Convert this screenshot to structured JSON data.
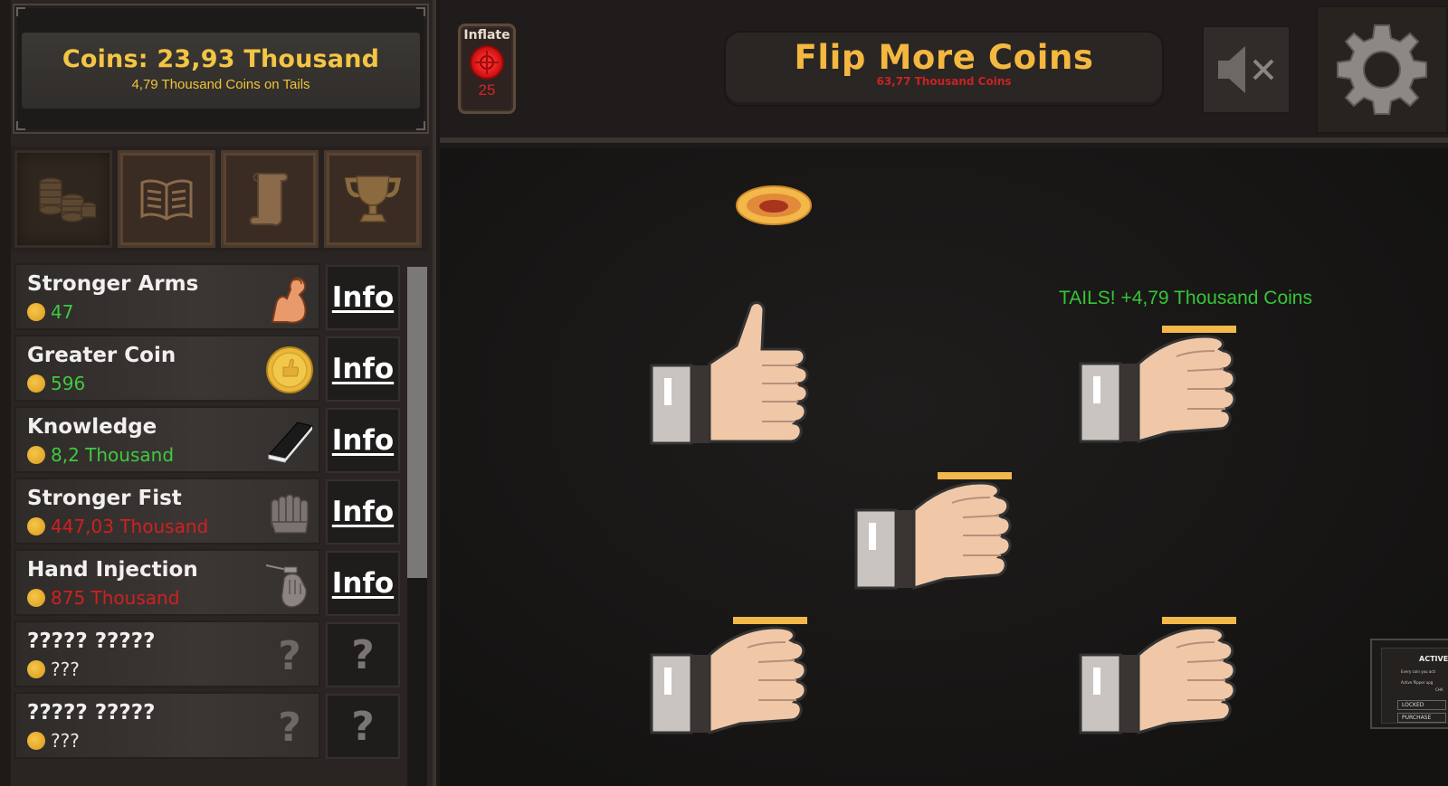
{
  "header": {
    "coins_label": "Coins: 23,93 Thousand",
    "coins_sub": "4,79 Thousand Coins on Tails"
  },
  "tabs": [
    {
      "name": "coins-tab",
      "icon": "coin-stack-icon",
      "active": true
    },
    {
      "name": "book-tab",
      "icon": "open-book-icon",
      "active": false
    },
    {
      "name": "scroll-tab",
      "icon": "scroll-icon",
      "active": false
    },
    {
      "name": "trophy-tab",
      "icon": "trophy-icon",
      "active": false
    }
  ],
  "upgrades": [
    {
      "name": "Stronger Arms",
      "cost": "47",
      "state": "afford",
      "icon": "flexed-arm-icon",
      "button": "Info"
    },
    {
      "name": "Greater Coin",
      "cost": "596",
      "state": "afford",
      "icon": "gold-coin-icon",
      "button": "Info"
    },
    {
      "name": "Knowledge",
      "cost": "8,2 Thousand",
      "state": "afford",
      "icon": "book-icon",
      "button": "Info"
    },
    {
      "name": "Stronger Fist",
      "cost": "447,03 Thousand",
      "state": "unafford",
      "icon": "fist-icon",
      "button": "Info"
    },
    {
      "name": "Hand Injection",
      "cost": "875 Thousand",
      "state": "unafford",
      "icon": "syringe-hand-icon",
      "button": "Info"
    },
    {
      "name": "????? ?????",
      "cost": "???",
      "state": "unknown",
      "icon": "question-icon",
      "button": "?"
    },
    {
      "name": "????? ?????",
      "cost": "???",
      "state": "unknown",
      "icon": "question-icon",
      "button": "?"
    }
  ],
  "inflate": {
    "label": "Inflate",
    "count": "25"
  },
  "flip": {
    "title": "Flip More Coins",
    "cost": "63,77 Thousand Coins"
  },
  "play": {
    "message": "TAILS! +4,79 Thousand Coins"
  },
  "mini_popup": {
    "title": "ACTIVE",
    "line1": "Every coin you acti",
    "line2": "Active flipper upg",
    "line3": "CHA",
    "locked": "LOCKED",
    "purchase": "PURCHASE"
  },
  "colors": {
    "gold_text": "#f4c544",
    "afford": "#3fc93f",
    "unafford": "#cf2121",
    "message": "#35c636",
    "flip_title": "#f4b840"
  }
}
